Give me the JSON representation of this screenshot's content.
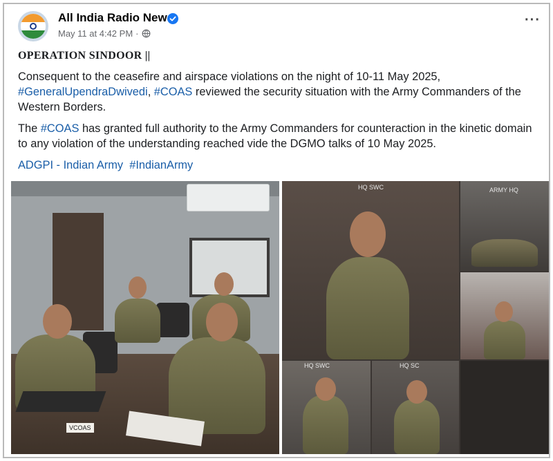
{
  "post": {
    "page_name": "All India Radio News",
    "timestamp": "May 11 at 4:42 PM",
    "separator": "·",
    "headline": "OPERATION SINDOOR  ||",
    "p1_text_a": "Consequent to the ceasefire and airspace violations on the night of 10-11 May 2025,",
    "p1_tag1": "#GeneralUpendraDwivedi",
    "p1_sep": ", ",
    "p1_tag2": "#COAS",
    "p1_text_b": " reviewed the security situation with the Army Commanders of the Western Borders.",
    "p2_text_a": "The ",
    "p2_tag": "#COAS",
    "p2_text_b": " has granted full authority to the Army Commanders for counteraction in the kinetic domain to any violation of the understanding reached vide the DGMO talks of 10 May 2025.",
    "mention1": "ADGPI - Indian Army",
    "mention2": "#IndianArmy"
  },
  "photo_labels": {
    "vc_main": "HQ SWC",
    "vc_top_right": "ARMY HQ",
    "vc_bottom_left": "HQ SWC",
    "vc_bottom_mid": "HQ SC",
    "nameplate": "VCOAS"
  },
  "icons": {
    "verified": "verified-badge-icon",
    "audience": "globe-icon",
    "more": "more-options-icon"
  },
  "colors": {
    "link": "#1a5ea8",
    "verified": "#1877f2",
    "meta": "#65676b"
  }
}
